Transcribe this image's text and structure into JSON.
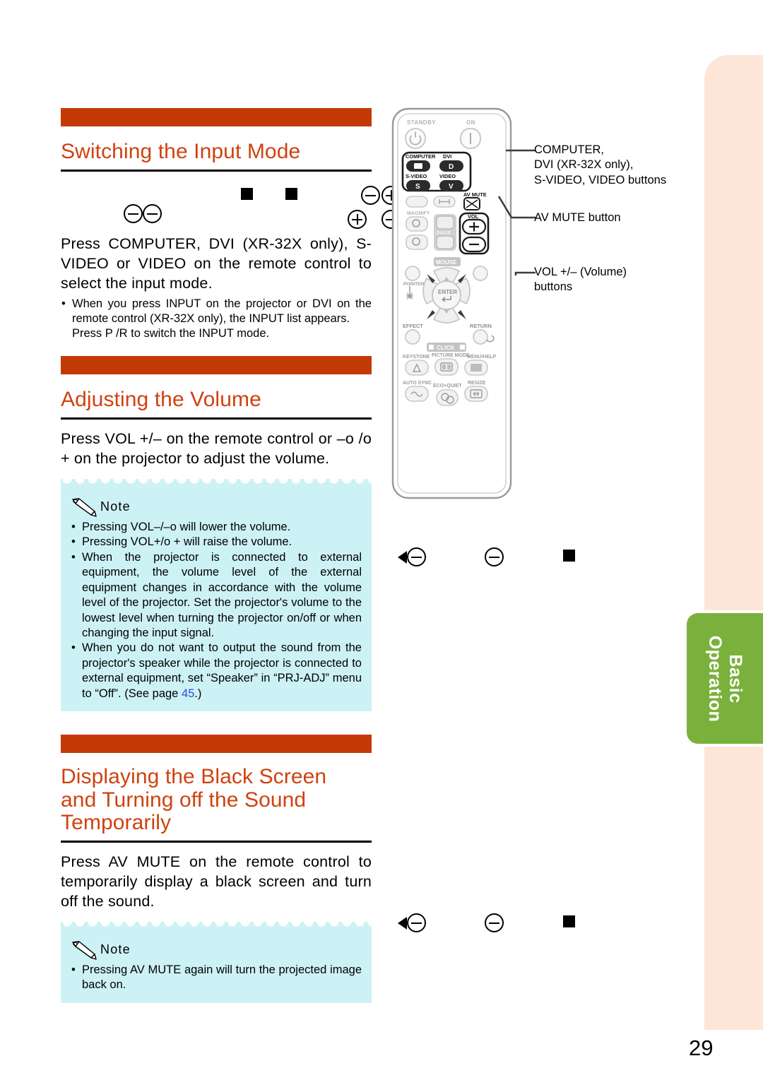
{
  "page": {
    "number": "29",
    "side_tab": "Basic\nOperation",
    "colors": {
      "accent_bar": "#c43a07",
      "heading": "#cf4210",
      "note_bg": "#cdf2f5",
      "side_strip": "#fde5d8",
      "side_tab": "#7ab13c",
      "page_ref_link": "#2b49d6"
    }
  },
  "sections": [
    {
      "title": "Switching the Input Mode",
      "body": "Press COMPUTER, DVI (XR-32X only), S-VIDEO or VIDEO on the remote control to select the input mode.",
      "bullets": [
        "When you press INPUT on the projector or DVI on the remote control (XR-32X only), the INPUT list appears.",
        "Press P /R  to switch the INPUT mode."
      ]
    },
    {
      "title": "Adjusting the Volume",
      "body": "Press VOL +/– on the remote control or –o /o + on the projector to adjust the volume.",
      "note": {
        "label": "Note",
        "bullets": [
          "Pressing VOL–/–o  will lower the volume.",
          "Pressing VOL+/o + will raise the volume.",
          "When the projector is connected to external equipment, the volume level of the external equipment changes in accordance with the volume level of the projector. Set the projector's volume to the lowest level when turning the projector on/off or when changing the input signal.",
          "When you do not want to output the sound from the projector's speaker while the projector is connected to external equipment, set “Speaker” in “PRJ-ADJ” menu to “Off”. (See page 45.)"
        ],
        "page_ref": "45"
      }
    },
    {
      "title": "Displaying the Black Screen and Turning off the Sound Temporarily",
      "title_lines": [
        "Displaying the Black Screen",
        "and Turning off the Sound",
        "Temporarily"
      ],
      "body": "Press AV MUTE on the remote control to temporarily display a black screen and turn off the sound.",
      "note": {
        "label": "Note",
        "bullets": [
          "Pressing AV MUTE again will turn the projected image back on."
        ]
      }
    }
  ],
  "remote": {
    "labels": {
      "standby": "STANDBY",
      "on": "ON",
      "computer": "COMPUTER",
      "dvi": "DVI",
      "svideo": "S-VIDEO",
      "video": "VIDEO",
      "dvi_glyph": "D",
      "svideo_glyph": "S",
      "video_glyph": "V",
      "av_mute": "AV MUTE",
      "magnify": "MAGNIFY",
      "vol": "VOL",
      "page": "PAGE",
      "mouse": "MOUSE",
      "pointer": "POINTER",
      "enter": "ENTER",
      "effect": "EFFECT",
      "return": "RETURN",
      "keystone": "KEYSTONE",
      "click": "CLICK",
      "menu_help": "MENU/HELP",
      "picture_mode": "PICTURE MODE",
      "auto_sync": "AUTO SYNC",
      "eco_quiet": "ECO+QUIET",
      "resize": "RESIZE"
    }
  },
  "callouts": [
    "COMPUTER,\nDVI (XR-32X only),\nS-VIDEO, VIDEO buttons",
    "AV MUTE button",
    "VOL +/– (Volume)\nbuttons"
  ],
  "callout_lines": {
    "c1": [
      "COMPUTER,",
      "DVI (XR-32X only),",
      "S-VIDEO, VIDEO buttons"
    ],
    "c2": [
      "AV MUTE button"
    ],
    "c3": [
      "VOL +/– (Volume)",
      "buttons"
    ]
  }
}
